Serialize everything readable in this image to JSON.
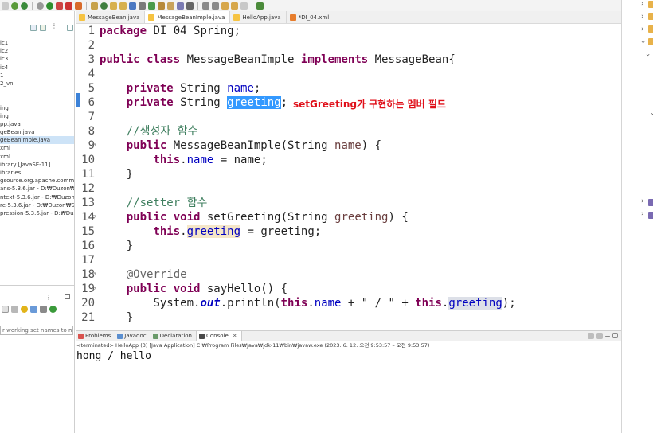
{
  "editor_tabs": [
    {
      "label": "MessageBean.java",
      "active": false
    },
    {
      "label": "MessageBeanImple.java",
      "active": true
    },
    {
      "label": "HelloApp.java",
      "active": false
    },
    {
      "label": "*DI_04.xml",
      "active": false
    }
  ],
  "explorer_items": [
    "ic1",
    "ic2",
    "ic3",
    "ic4",
    "1",
    "2_vnl",
    "",
    "",
    "ing",
    "ing",
    "pp.java",
    "geBean.java",
    "geBeanImple.java",
    "xml",
    "xml",
    "ibrary [JavaSE-11]",
    "ibraries",
    "gsource.org.apache.commons",
    "ans-5.3.6.jar - D:₩Duzon₩Spr",
    "ntext-5.3.6.jar - D:₩Duzon₩Sp",
    "re-5.3.6.jar - D:₩Duzon₩Sprin",
    "pression-5.3.6.jar - D:₩Duzon"
  ],
  "filter_placeholder": "r working set names to matc",
  "code_lines": [
    {
      "n": "1"
    },
    {
      "n": "2"
    },
    {
      "n": "3"
    },
    {
      "n": "4"
    },
    {
      "n": "5"
    },
    {
      "n": "6"
    },
    {
      "n": "7"
    },
    {
      "n": "8"
    },
    {
      "n": "9"
    },
    {
      "n": "10"
    },
    {
      "n": "11"
    },
    {
      "n": "12"
    },
    {
      "n": "13"
    },
    {
      "n": "14"
    },
    {
      "n": "15"
    },
    {
      "n": "16"
    },
    {
      "n": "17"
    },
    {
      "n": "18"
    },
    {
      "n": "19"
    },
    {
      "n": "20"
    },
    {
      "n": "21"
    }
  ],
  "code": {
    "l1_kw": "package",
    "l1_rest": " DI_04_Spring;",
    "l3_kw1": "public",
    "l3_kw2": "class",
    "l3_name": " MessageBeanImple ",
    "l3_kw3": "implements",
    "l3_rest": " MessageBean{",
    "l5_kw": "private",
    "l5_type": " String ",
    "l5_field": "name",
    "l5_end": ";",
    "l6_kw": "private",
    "l6_type": " String ",
    "l6_field": "greeting",
    "l6_end": ";",
    "l8_comment": "//생성자 함수",
    "l9_kw": "public",
    "l9_rest1": " MessageBeanImple(String ",
    "l9_param": "name",
    "l9_rest2": ") {",
    "l10_kw": "this",
    "l10_dot": ".",
    "l10_field": "name",
    "l10_rest": " = name;",
    "l11": "}",
    "l13_comment": "//setter 함수",
    "l14_kw1": "public",
    "l14_kw2": "void",
    "l14_rest1": " setGreeting(String ",
    "l14_param": "greeting",
    "l14_rest2": ") {",
    "l15_kw": "this",
    "l15_dot": ".",
    "l15_field": "greeting",
    "l15_rest": " = greeting;",
    "l16": "}",
    "l18_ann": "@Override",
    "l19_kw1": "public",
    "l19_kw2": "void",
    "l19_rest": " sayHello() {",
    "l20_a": "System.",
    "l20_out": "out",
    "l20_b": ".println(",
    "l20_kw1": "this",
    "l20_c": ".",
    "l20_f1": "name",
    "l20_d": " + \" / \" + ",
    "l20_kw2": "this",
    "l20_e": ".",
    "l20_f2": "greeting",
    "l20_end": ");",
    "l21": "}"
  },
  "callout_text": "setGreeting가 구현하는 멤버 필드",
  "console": {
    "tabs": [
      {
        "label": "Problems",
        "active": false
      },
      {
        "label": "Javadoc",
        "active": false
      },
      {
        "label": "Declaration",
        "active": false
      },
      {
        "label": "Console",
        "active": true
      }
    ],
    "status": "<terminated> HelloApp (3) [Java Application] C:₩Program Files₩Java₩jdk-11₩bin₩javaw.exe  (2023. 6. 12. 오전 9:53:57 – 오전 9:53:57)",
    "output": "hong / hello"
  },
  "colors": {
    "keyword": "#7f0055",
    "comment": "#3f7f5f",
    "field": "#0000c0",
    "selection": "#3399ff",
    "callout": "#e0101a"
  }
}
